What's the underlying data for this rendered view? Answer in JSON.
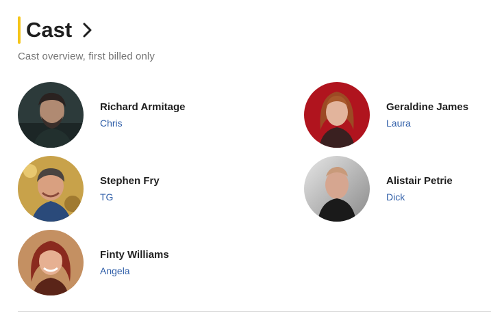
{
  "section": {
    "title": "Cast",
    "subtitle": "Cast overview, first billed only"
  },
  "icons": {
    "header_link": "chevron-right-icon"
  },
  "colors": {
    "accent": "#f5c518",
    "role_link": "#2f5ea8"
  },
  "cast": [
    {
      "actor": "Richard Armitage",
      "role": "Chris"
    },
    {
      "actor": "Geraldine James",
      "role": "Laura"
    },
    {
      "actor": "Stephen Fry",
      "role": "TG"
    },
    {
      "actor": "Alistair Petrie",
      "role": "Dick"
    },
    {
      "actor": "Finty Williams",
      "role": "Angela"
    }
  ]
}
